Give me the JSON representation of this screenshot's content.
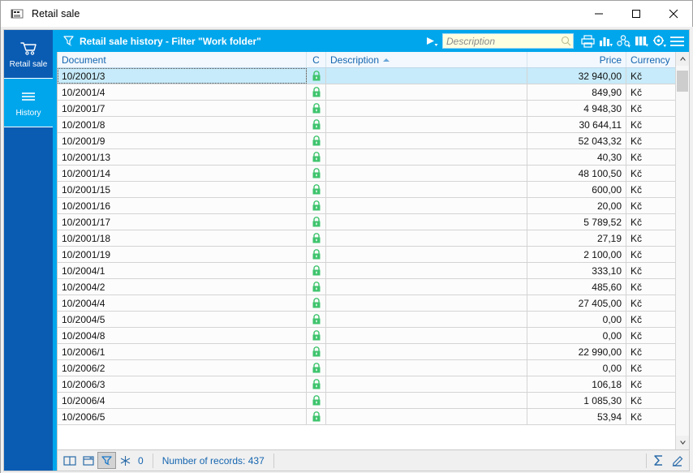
{
  "window": {
    "title": "Retail sale",
    "icon": "app-icon",
    "controls": {
      "minimize": "minimize-icon",
      "maximize": "maximize-icon",
      "close": "close-icon"
    }
  },
  "sidebar": {
    "items": [
      {
        "label": "Retail sale",
        "icon": "shopping-cart-icon",
        "active": false
      },
      {
        "label": "History",
        "icon": "hamburger-list-icon",
        "active": true
      }
    ]
  },
  "toolbar": {
    "filter_icon": "filter-icon",
    "title": "Retail sale history - Filter \"Work folder\"",
    "play_icon": "play-dropdown-icon",
    "search": {
      "placeholder": "Description",
      "value": "",
      "icon": "magnifier-icon"
    },
    "buttons": [
      {
        "name": "print-icon",
        "title": "Print"
      },
      {
        "name": "chart-icon",
        "title": "Chart"
      },
      {
        "name": "share-icon",
        "title": "Share"
      },
      {
        "name": "columns-icon",
        "title": "Columns"
      },
      {
        "name": "settings-gear-icon",
        "title": "Settings"
      },
      {
        "name": "menu-icon",
        "title": "Menu"
      }
    ]
  },
  "grid": {
    "columns": [
      {
        "key": "document",
        "label": "Document",
        "align": "left",
        "sort": null
      },
      {
        "key": "c",
        "label": "C",
        "align": "center",
        "sort": null
      },
      {
        "key": "description",
        "label": "Description",
        "align": "left",
        "sort": "asc"
      },
      {
        "key": "price",
        "label": "Price",
        "align": "right",
        "sort": null
      },
      {
        "key": "currency",
        "label": "Currency",
        "align": "left",
        "sort": null
      }
    ],
    "lock_icon": "green-padlock-icon",
    "rows": [
      {
        "document": "10/2001/3",
        "c": "locked",
        "description": "",
        "price": "32 940,00",
        "currency": "Kč",
        "selected": true
      },
      {
        "document": "10/2001/4",
        "c": "locked",
        "description": "",
        "price": "849,90",
        "currency": "Kč",
        "selected": false
      },
      {
        "document": "10/2001/7",
        "c": "locked",
        "description": "",
        "price": "4 948,30",
        "currency": "Kč",
        "selected": false
      },
      {
        "document": "10/2001/8",
        "c": "locked",
        "description": "",
        "price": "30 644,11",
        "currency": "Kč",
        "selected": false
      },
      {
        "document": "10/2001/9",
        "c": "locked",
        "description": "",
        "price": "52 043,32",
        "currency": "Kč",
        "selected": false
      },
      {
        "document": "10/2001/13",
        "c": "locked",
        "description": "",
        "price": "40,30",
        "currency": "Kč",
        "selected": false
      },
      {
        "document": "10/2001/14",
        "c": "locked",
        "description": "",
        "price": "48 100,50",
        "currency": "Kč",
        "selected": false
      },
      {
        "document": "10/2001/15",
        "c": "locked",
        "description": "",
        "price": "600,00",
        "currency": "Kč",
        "selected": false
      },
      {
        "document": "10/2001/16",
        "c": "locked",
        "description": "",
        "price": "20,00",
        "currency": "Kč",
        "selected": false
      },
      {
        "document": "10/2001/17",
        "c": "locked",
        "description": "",
        "price": "5 789,52",
        "currency": "Kč",
        "selected": false
      },
      {
        "document": "10/2001/18",
        "c": "locked",
        "description": "",
        "price": "27,19",
        "currency": "Kč",
        "selected": false
      },
      {
        "document": "10/2001/19",
        "c": "locked",
        "description": "",
        "price": "2 100,00",
        "currency": "Kč",
        "selected": false
      },
      {
        "document": "10/2004/1",
        "c": "locked",
        "description": "",
        "price": "333,10",
        "currency": "Kč",
        "selected": false
      },
      {
        "document": "10/2004/2",
        "c": "locked",
        "description": "",
        "price": "485,60",
        "currency": "Kč",
        "selected": false
      },
      {
        "document": "10/2004/4",
        "c": "locked",
        "description": "",
        "price": "27 405,00",
        "currency": "Kč",
        "selected": false
      },
      {
        "document": "10/2004/5",
        "c": "locked",
        "description": "",
        "price": "0,00",
        "currency": "Kč",
        "selected": false
      },
      {
        "document": "10/2004/8",
        "c": "locked",
        "description": "",
        "price": "0,00",
        "currency": "Kč",
        "selected": false
      },
      {
        "document": "10/2006/1",
        "c": "locked",
        "description": "",
        "price": "22 990,00",
        "currency": "Kč",
        "selected": false
      },
      {
        "document": "10/2006/2",
        "c": "locked",
        "description": "",
        "price": "0,00",
        "currency": "Kč",
        "selected": false
      },
      {
        "document": "10/2006/3",
        "c": "locked",
        "description": "",
        "price": "106,18",
        "currency": "Kč",
        "selected": false
      },
      {
        "document": "10/2006/4",
        "c": "locked",
        "description": "",
        "price": "1 085,30",
        "currency": "Kč",
        "selected": false
      },
      {
        "document": "10/2006/5",
        "c": "locked",
        "description": "",
        "price": "53,94",
        "currency": "Kč",
        "selected": false
      }
    ]
  },
  "scrollbar": {
    "up_icon": "scroll-up-icon",
    "down_icon": "scroll-down-icon"
  },
  "statusbar": {
    "book_icon": "book-icon",
    "archive_icon": "archive-box-icon",
    "filter_icon": "filter-icon",
    "snowflake_icon": "snowflake-icon",
    "snowflake_count": "0",
    "records_text": "Number of records: 437",
    "sum_icon": "sigma-sum-icon",
    "edit_icon": "pencil-edit-icon"
  },
  "colors": {
    "accent_cyan": "#00a6ec",
    "sidebar_blue": "#0a5cb3",
    "selection": "#c7ebfa",
    "header_text": "#1565b0",
    "lock_green": "#3ec46d",
    "search_bg": "#feffe1"
  }
}
